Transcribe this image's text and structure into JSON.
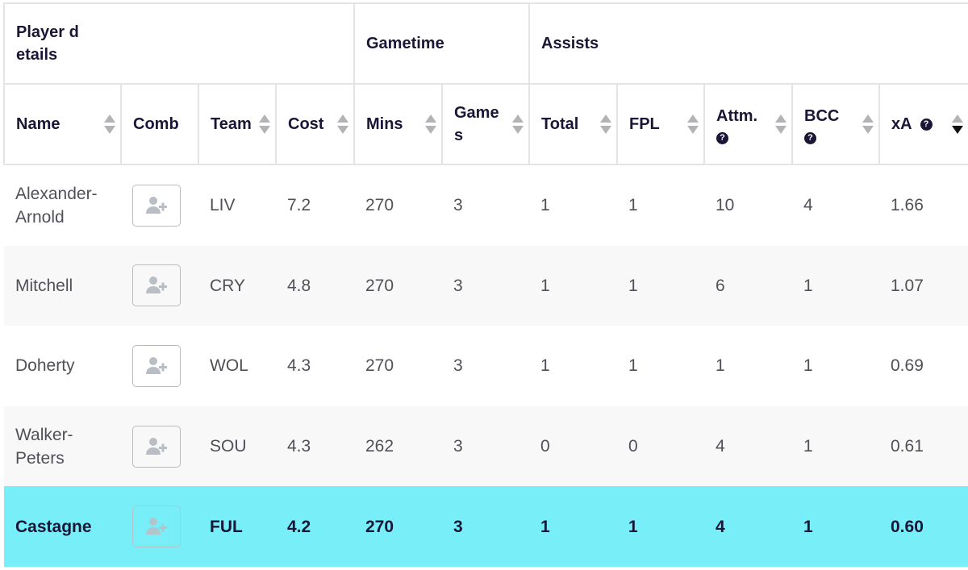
{
  "colors": {
    "header_text": "#1b1536",
    "cell_text": "#505058",
    "row_alt_bg": "#f8f8f8",
    "highlight_bg": "#78eef9",
    "border": "#e4e4e6",
    "sort_inactive": "#b3b3b6",
    "sort_active": "#111111"
  },
  "groups": [
    {
      "label": "Player details",
      "span": 4
    },
    {
      "label": "Gametime",
      "span": 2
    },
    {
      "label": "Assists",
      "span": 5
    }
  ],
  "columns": [
    {
      "key": "name",
      "label": "Name",
      "sortable": true,
      "help": false
    },
    {
      "key": "comb",
      "label": "Comb",
      "sortable": false,
      "help": false
    },
    {
      "key": "team",
      "label": "Team",
      "sortable": true,
      "help": false
    },
    {
      "key": "cost",
      "label": "Cost",
      "sortable": true,
      "help": false
    },
    {
      "key": "mins",
      "label": "Mins",
      "sortable": true,
      "help": false
    },
    {
      "key": "games",
      "label": "Games",
      "sortable": true,
      "help": false
    },
    {
      "key": "total",
      "label": "Total",
      "sortable": true,
      "help": false
    },
    {
      "key": "fpl",
      "label": "FPL",
      "sortable": true,
      "help": false
    },
    {
      "key": "attm",
      "label": "Attm.",
      "sortable": true,
      "help": true
    },
    {
      "key": "bcc",
      "label": "BCC",
      "sortable": true,
      "help": true
    },
    {
      "key": "xa",
      "label": "xA",
      "sortable": true,
      "help": true,
      "sort_direction": "descending"
    }
  ],
  "help_icon": "question-circle-icon",
  "comb_icon": "add-user-icon",
  "rows": [
    {
      "name": "Alexander-Arnold",
      "team": "LIV",
      "cost": "7.2",
      "mins": "270",
      "games": "3",
      "total": "1",
      "fpl": "1",
      "attm": "10",
      "bcc": "4",
      "xa": "1.66",
      "highlighted": false
    },
    {
      "name": "Mitchell",
      "team": "CRY",
      "cost": "4.8",
      "mins": "270",
      "games": "3",
      "total": "1",
      "fpl": "1",
      "attm": "6",
      "bcc": "1",
      "xa": "1.07",
      "highlighted": false
    },
    {
      "name": "Doherty",
      "team": "WOL",
      "cost": "4.3",
      "mins": "270",
      "games": "3",
      "total": "1",
      "fpl": "1",
      "attm": "1",
      "bcc": "1",
      "xa": "0.69",
      "highlighted": false
    },
    {
      "name": "Walker-Peters",
      "team": "SOU",
      "cost": "4.3",
      "mins": "262",
      "games": "3",
      "total": "0",
      "fpl": "0",
      "attm": "4",
      "bcc": "1",
      "xa": "0.61",
      "highlighted": false
    },
    {
      "name": "Castagne",
      "team": "FUL",
      "cost": "4.2",
      "mins": "270",
      "games": "3",
      "total": "1",
      "fpl": "1",
      "attm": "4",
      "bcc": "1",
      "xa": "0.60",
      "highlighted": true
    }
  ]
}
